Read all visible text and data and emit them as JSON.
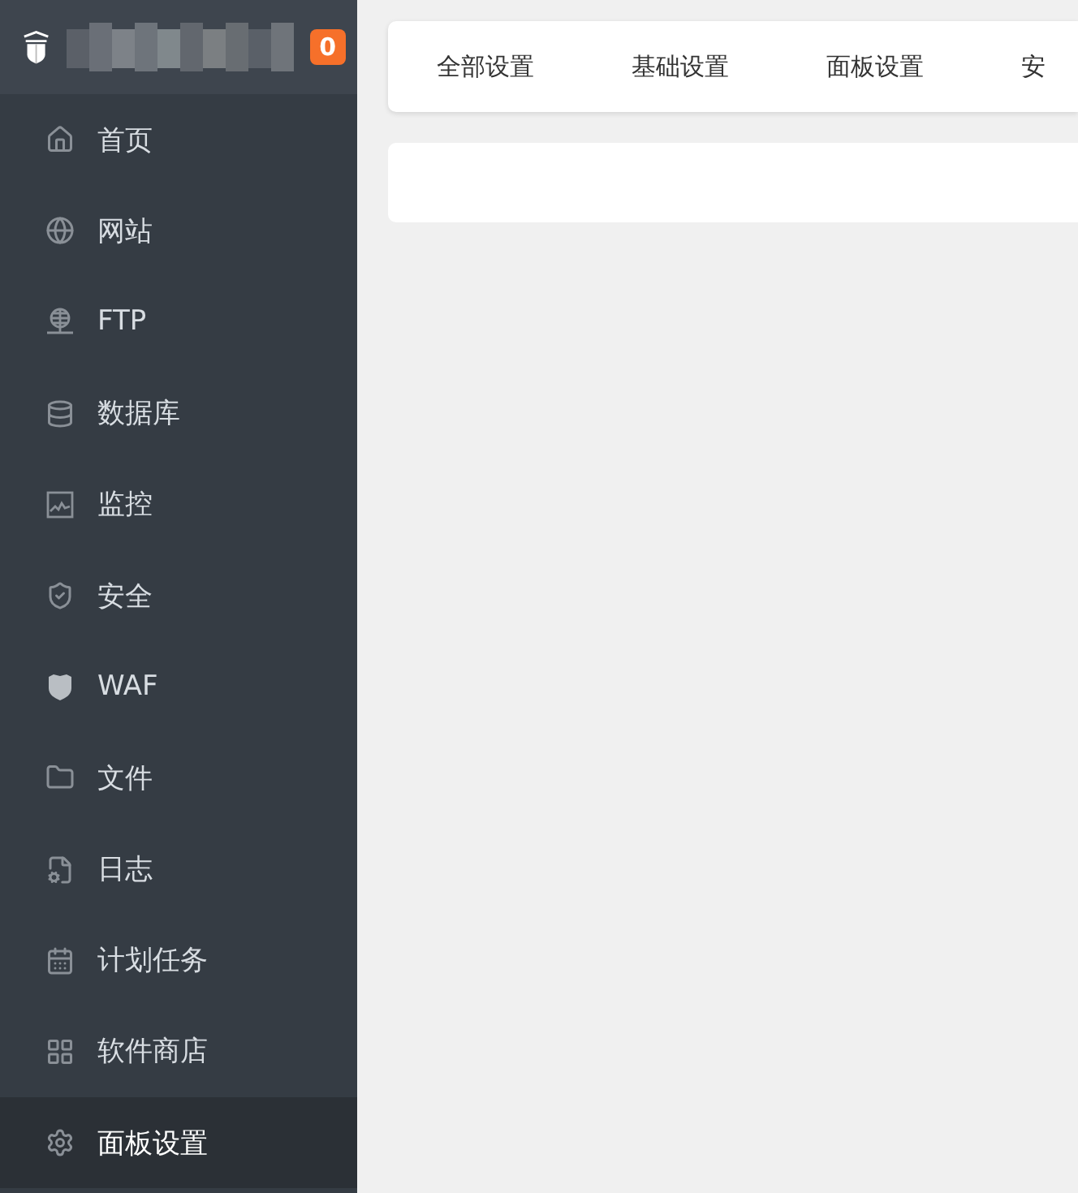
{
  "sidebar": {
    "header": {
      "badge": "0"
    },
    "items": [
      {
        "label": "首页",
        "selected": false
      },
      {
        "label": "网站",
        "selected": false
      },
      {
        "label": "FTP",
        "selected": false
      },
      {
        "label": "数据库",
        "selected": false
      },
      {
        "label": "监控",
        "selected": false
      },
      {
        "label": "安全",
        "selected": false
      },
      {
        "label": "WAF",
        "selected": false
      },
      {
        "label": "文件",
        "selected": false
      },
      {
        "label": "日志",
        "selected": false
      },
      {
        "label": "计划任务",
        "selected": false
      },
      {
        "label": "软件商店",
        "selected": false
      },
      {
        "label": "面板设置",
        "selected": true
      }
    ]
  },
  "tabs": [
    {
      "label": "全部设置"
    },
    {
      "label": "基础设置"
    },
    {
      "label": "面板设置"
    },
    {
      "label": "安"
    }
  ]
}
